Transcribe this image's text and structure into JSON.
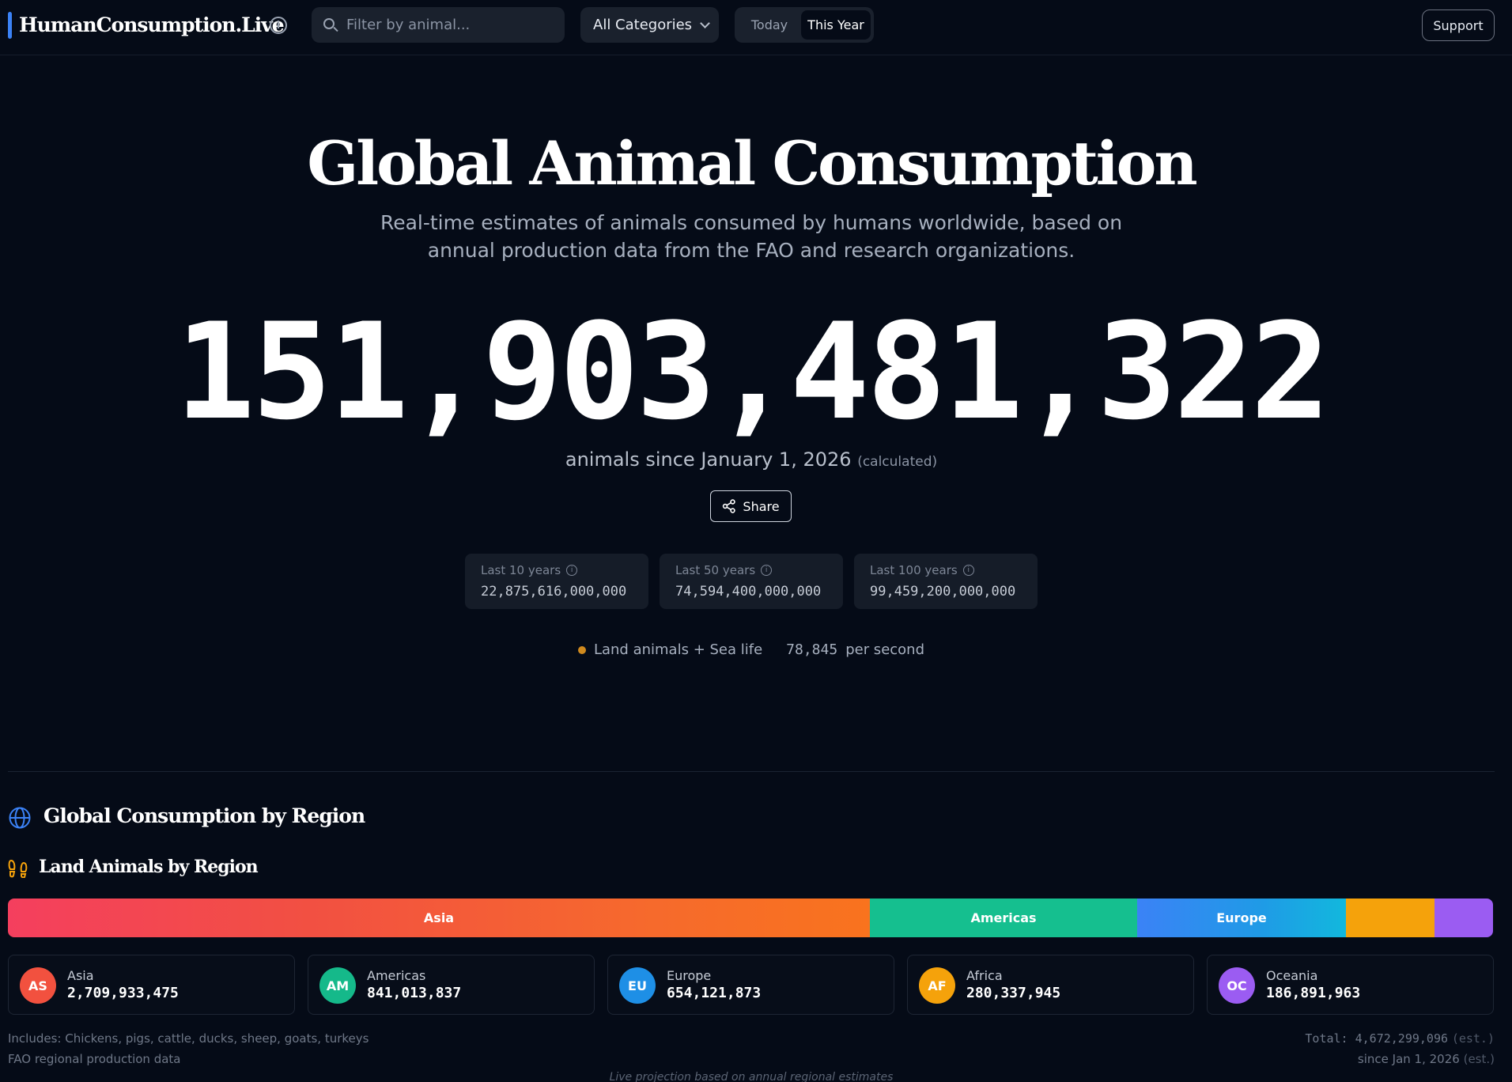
{
  "header": {
    "brand": "HumanConsumption.Live",
    "search_placeholder": "Filter by animal...",
    "category_selected": "All Categories",
    "period_options": [
      "Today",
      "This Year"
    ],
    "period_active": "This Year",
    "support_label": "Support"
  },
  "hero": {
    "title": "Global Animal Consumption",
    "subtitle": "Real-time estimates of animals consumed by humans worldwide, based on annual production data from the FAO and research organizations.",
    "counter": "151,903,481,322",
    "since_text": "animals since January 1, 2026",
    "since_note": "(calculated)",
    "share_label": "Share"
  },
  "history": [
    {
      "label": "Last 10 years",
      "value": "22,875,616,000,000"
    },
    {
      "label": "Last 50 years",
      "value": "74,594,400,000,000"
    },
    {
      "label": "Last 100 years",
      "value": "99,459,200,000,000"
    }
  ],
  "rate": {
    "label": "Land animals + Sea life",
    "value": "78,845",
    "unit": "per second",
    "dot_color": "#d08a1e"
  },
  "region_section": {
    "title": "Global Consumption by Region",
    "subtitle": "Land Animals by Region",
    "bar_labels": {
      "asia": "Asia",
      "americas": "Americas",
      "europe": "Europe"
    },
    "regions": [
      {
        "code": "AS",
        "name": "Asia",
        "value": "2,709,933,475",
        "color": "#f2513f"
      },
      {
        "code": "AM",
        "name": "Americas",
        "value": "841,013,837",
        "color": "#15b98a"
      },
      {
        "code": "EU",
        "name": "Europe",
        "value": "654,121,873",
        "color": "#1e8fe6"
      },
      {
        "code": "AF",
        "name": "Africa",
        "value": "280,337,945",
        "color": "#f5a20b"
      },
      {
        "code": "OC",
        "name": "Oceania",
        "value": "186,891,963",
        "color": "#9b5cf2"
      }
    ],
    "includes": "Includes: Chickens, pigs, cattle, ducks, sheep, goats, turkeys",
    "source": "FAO regional production data",
    "total": "Total: 4,672,299,096",
    "total_est": "(est.)",
    "since": "since Jan 1, 2026",
    "since_est": "(est.)",
    "live_note": "Live projection based on annual regional estimates"
  }
}
